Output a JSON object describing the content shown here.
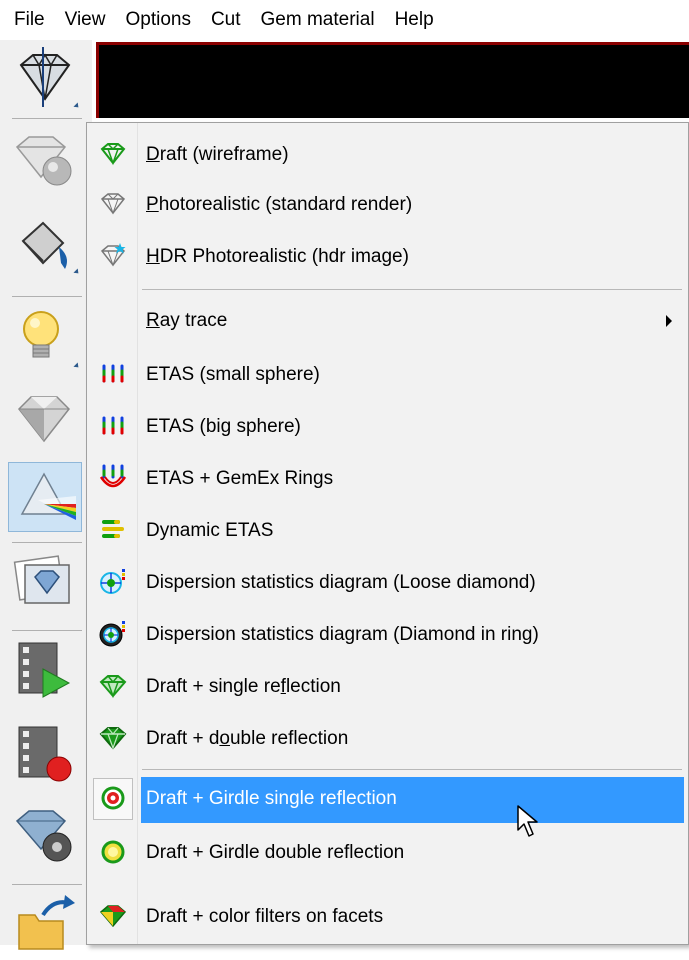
{
  "menubar": {
    "items": [
      "File",
      "View",
      "Options",
      "Cut",
      "Gem material",
      "Help"
    ]
  },
  "colors": {
    "highlight": "#3399ff",
    "menu_bg": "#f2f2f2",
    "etas_red": "#e00000",
    "etas_green": "#10a010",
    "etas_blue": "#1040e0",
    "diamond_green": "#1a9a1a"
  },
  "toolbar": {
    "icons": [
      "diamond-wireframe-icon",
      "diamond-sphere-icon",
      "paint-bucket-icon",
      "light-bulb-icon",
      "diamond-render-icon",
      "prism-spectrum-icon",
      "gem-photo-icon",
      "video-play-icon",
      "video-record-icon",
      "diamond-wheel-icon",
      "folder-export-icon"
    ],
    "active_index": 5
  },
  "popup": {
    "items": [
      {
        "pre": "",
        "acc": "D",
        "post": "raft (wireframe)",
        "icon": "wireframe-diamond-icon"
      },
      {
        "pre": "",
        "acc": "P",
        "post": "hotorealistic (standard render)",
        "icon": "outline-diamond-icon"
      },
      {
        "pre": "",
        "acc": "H",
        "post": "DR Photorealistic (hdr image)",
        "icon": "hdr-diamond-icon"
      },
      {
        "pre": "",
        "acc": "R",
        "post": "ay trace",
        "icon": "",
        "submenu": true
      },
      {
        "pre": "ETAS (small sphere)",
        "acc": "",
        "post": "",
        "icon": "etas-small-sphere-icon"
      },
      {
        "pre": "ETAS (big sphere)",
        "acc": "",
        "post": "",
        "icon": "etas-big-sphere-icon"
      },
      {
        "pre": "ETAS + GemEx Rings",
        "acc": "",
        "post": "",
        "icon": "etas-gemex-rings-icon"
      },
      {
        "pre": "Dynamic ETAS",
        "acc": "",
        "post": "",
        "icon": "dynamic-etas-icon"
      },
      {
        "pre": "Dispersion statistics diagram (Loose diamond)",
        "acc": "",
        "post": "",
        "icon": "dispersion-loose-icon"
      },
      {
        "pre": "Dispersion statistics diagram (Diamond in ring)",
        "acc": "",
        "post": "",
        "icon": "dispersion-ring-icon"
      },
      {
        "pre": "Draft + single re",
        "acc": "f",
        "post": "lection",
        "icon": "single-reflection-diamond-icon"
      },
      {
        "pre": "Draft + d",
        "acc": "o",
        "post": "uble reflection",
        "icon": "double-reflection-diamond-icon"
      },
      {
        "pre": "Draft + Girdle single reflection",
        "acc": "",
        "post": "",
        "icon": "girdle-single-reflection-icon",
        "highlighted": true
      },
      {
        "pre": "Draft + Girdle double reflection",
        "acc": "",
        "post": "",
        "icon": "girdle-double-reflection-icon"
      },
      {
        "pre": "Draft + color filters on facets",
        "acc": "",
        "post": "",
        "icon": "color-filters-diamond-icon"
      }
    ]
  }
}
